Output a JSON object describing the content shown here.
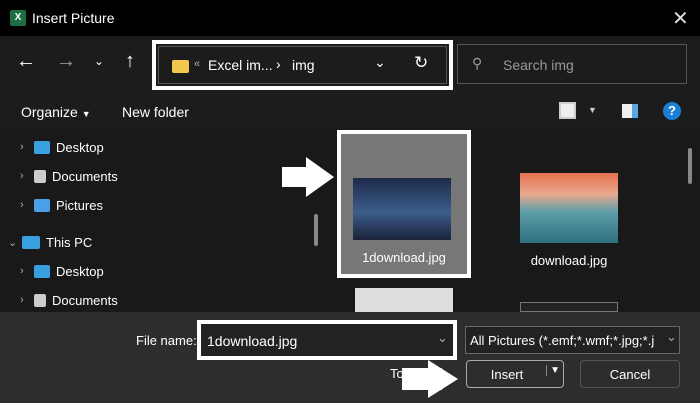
{
  "title": "Insert Picture",
  "nav": {
    "path_prefix": "«",
    "path_parent": "Excel im...",
    "path_sep": "›",
    "path_current": "img",
    "search_placeholder": "Search img"
  },
  "toolbar": {
    "organize": "Organize",
    "new_folder": "New folder",
    "help": "?"
  },
  "tree": [
    {
      "label": "Desktop",
      "level": 1
    },
    {
      "label": "Documents",
      "level": 1
    },
    {
      "label": "Pictures",
      "level": 1
    },
    {
      "label": "This PC",
      "level": 0
    },
    {
      "label": "Desktop",
      "level": 1
    },
    {
      "label": "Documents",
      "level": 1
    }
  ],
  "files": [
    {
      "name": "1download.jpg",
      "selected": true
    },
    {
      "name": "download.jpg",
      "selected": false
    }
  ],
  "bottom": {
    "file_name_label": "File name:",
    "file_name_value": "1download.jpg",
    "filter": "All Pictures (*.emf;*.wmf;*.jpg;*.j",
    "tools": "Tools",
    "insert": "Insert",
    "cancel": "Cancel"
  }
}
